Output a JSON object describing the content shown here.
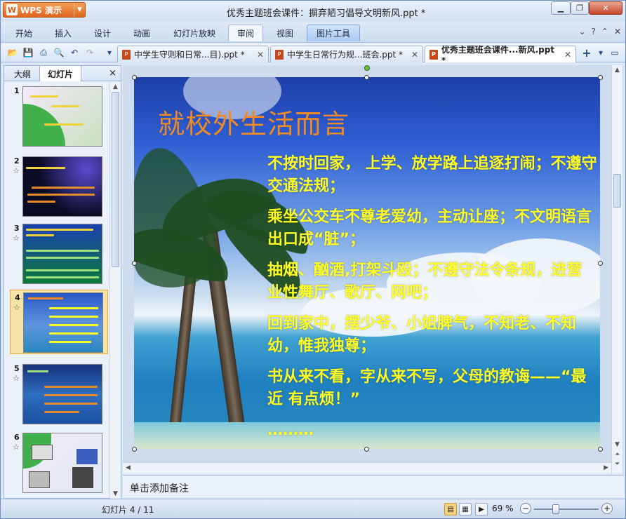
{
  "app": {
    "menu_button_label": "WPS 演示",
    "window_title": "优秀主题班会课件：摒弃陋习倡导文明新风.ppt *",
    "window_controls": [
      "minimize-icon",
      "restore-icon",
      "close-icon"
    ]
  },
  "menu": {
    "tabs": [
      "开始",
      "插入",
      "设计",
      "动画",
      "幻灯片放映",
      "审阅",
      "视图",
      "图片工具"
    ],
    "right_icons": [
      "chevron-down-icon",
      "help-icon",
      "minimize-ribbon-icon",
      "close-icon"
    ]
  },
  "quick_access": [
    "open-icon",
    "save-icon",
    "print-icon",
    "print-preview-icon",
    "undo-icon",
    "redo-icon",
    "customize-icon"
  ],
  "doc_tabs": [
    {
      "label": "中学生守则和日常...目).ppt *",
      "active": false
    },
    {
      "label": "中学生日常行为规...班会.ppt *",
      "active": false
    },
    {
      "label": "优秀主题班会课件...新风.ppt *",
      "active": true
    }
  ],
  "left_panel": {
    "tab_outline": "大纲",
    "tab_slides": "幻灯片",
    "close_glyph": "×",
    "thumbnails": [
      {
        "num": "1",
        "selected": false,
        "star": ""
      },
      {
        "num": "2",
        "selected": false,
        "star": "☆"
      },
      {
        "num": "3",
        "selected": false,
        "star": "☆"
      },
      {
        "num": "4",
        "selected": true,
        "star": "☆"
      },
      {
        "num": "5",
        "selected": false,
        "star": "☆"
      },
      {
        "num": "6",
        "selected": false,
        "star": "☆"
      }
    ]
  },
  "slide": {
    "title": "就校外生活而言",
    "bullets": [
      "不按时回家， 上学、放学路上追逐打闹；不遵守交通法规；",
      "乘坐公交车不尊老爱幼，主动让座；不文明语言出口成“脏”；",
      "抽烟、酗酒,打架斗殴；不遵守法令条规，进营业性舞厅、歌厅、网吧；",
      "回到家中，摆少爷、小姐脾气，不知老、不知幼，惟我独尊；",
      "书从来不看，字从来不写，父母的教诲——“最近 有点烦！”",
      "………"
    ]
  },
  "notes": {
    "placeholder": "单击添加备注"
  },
  "status": {
    "slide_counter": "幻灯片 4 / 11",
    "zoom": "69 %",
    "zoom_minus": "−",
    "zoom_plus": "+"
  }
}
